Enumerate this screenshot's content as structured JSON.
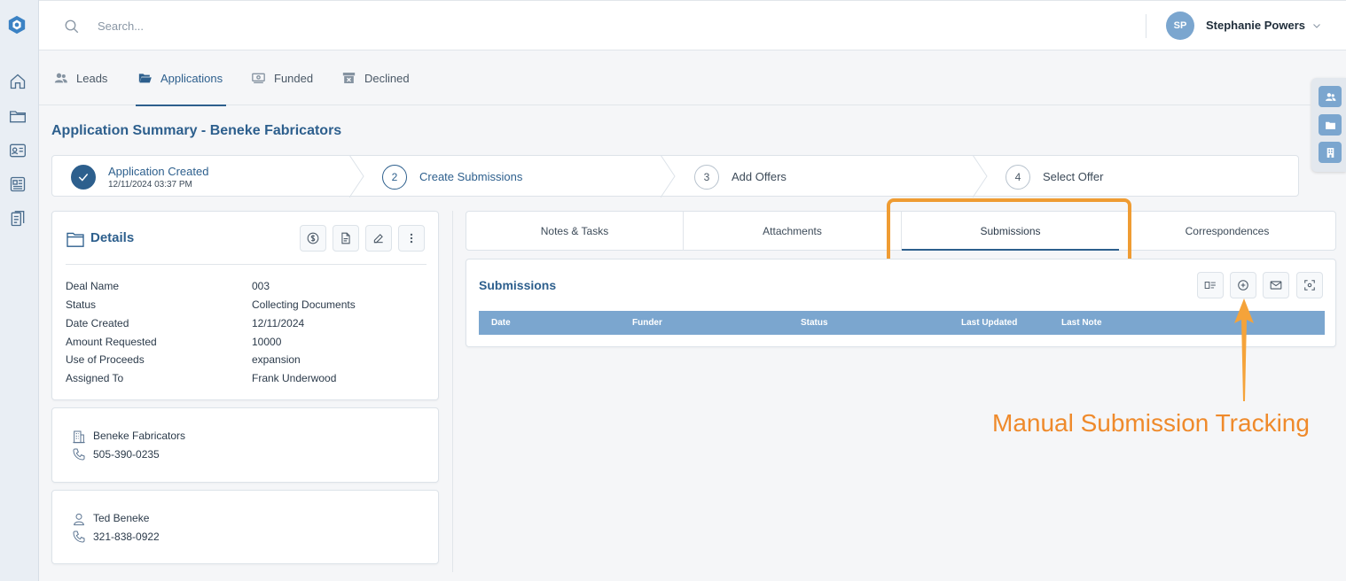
{
  "header": {
    "search_placeholder": "Search...",
    "user_initials": "SP",
    "user_name": "Stephanie Powers"
  },
  "tabs": [
    {
      "label": "Leads",
      "icon": "users-icon"
    },
    {
      "label": "Applications",
      "icon": "folder-icon",
      "active": true
    },
    {
      "label": "Funded",
      "icon": "money-icon"
    },
    {
      "label": "Declined",
      "icon": "archive-icon"
    }
  ],
  "page": {
    "title": "Application Summary - Beneke Fabricators"
  },
  "stepper": {
    "steps": [
      {
        "number": "",
        "label": "Application Created",
        "sublabel": "12/11/2024 03:37 PM",
        "state": "done"
      },
      {
        "number": "2",
        "label": "Create Submissions",
        "state": "current"
      },
      {
        "number": "3",
        "label": "Add Offers",
        "state": "pending"
      },
      {
        "number": "4",
        "label": "Select Offer",
        "state": "pending"
      }
    ]
  },
  "details": {
    "title": "Details",
    "fields": [
      {
        "label": "Deal Name",
        "value": "003"
      },
      {
        "label": "Status",
        "value": "Collecting Documents"
      },
      {
        "label": "Date Created",
        "value": "12/11/2024"
      },
      {
        "label": "Amount Requested",
        "value": "10000"
      },
      {
        "label": "Use of Proceeds",
        "value": "expansion"
      },
      {
        "label": "Assigned To",
        "value": "Frank Underwood"
      }
    ]
  },
  "business": {
    "name": "Beneke Fabricators",
    "phone": "505-390-0235"
  },
  "contact": {
    "name": "Ted Beneke",
    "phone": "321-838-0922"
  },
  "right_tabs": [
    {
      "label": "Notes & Tasks"
    },
    {
      "label": "Attachments"
    },
    {
      "label": "Submissions",
      "active": true
    },
    {
      "label": "Correspondences"
    }
  ],
  "submissions": {
    "title": "Submissions",
    "columns": [
      "Date",
      "Funder",
      "Status",
      "Last Updated",
      "Last Note"
    ]
  },
  "annotation": {
    "text": "Manual Submission Tracking",
    "color": "#ef8a2b"
  },
  "colors": {
    "primary": "#2d5f8d",
    "accent_light": "#7ba6cf",
    "highlight": "#ef9c33"
  }
}
